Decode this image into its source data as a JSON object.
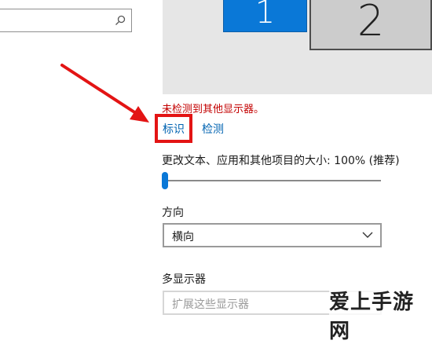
{
  "search": {
    "placeholder": ""
  },
  "monitors": [
    {
      "label": "1",
      "color": "#0a78d7",
      "selected": true
    },
    {
      "label": "2",
      "color": "#cccccc",
      "selected": false
    }
  ],
  "display": {
    "status_message": "未检测到其他显示器。",
    "status_color": "#c30000",
    "identify_label": "标识",
    "detect_label": "检测",
    "highlight_color": "#e31414"
  },
  "scale": {
    "label": "更改文本、应用和其他项目的大小: 100% (推荐)",
    "value_percent": 100,
    "slider_position": 0
  },
  "orientation": {
    "label": "方向",
    "selected": "横向"
  },
  "multiple_displays": {
    "label": "多显示器",
    "selected": "扩展这些显示器"
  },
  "watermark": {
    "text": "爱上手游网"
  },
  "colors": {
    "accent": "#0a78d7",
    "link": "#0063b1"
  }
}
